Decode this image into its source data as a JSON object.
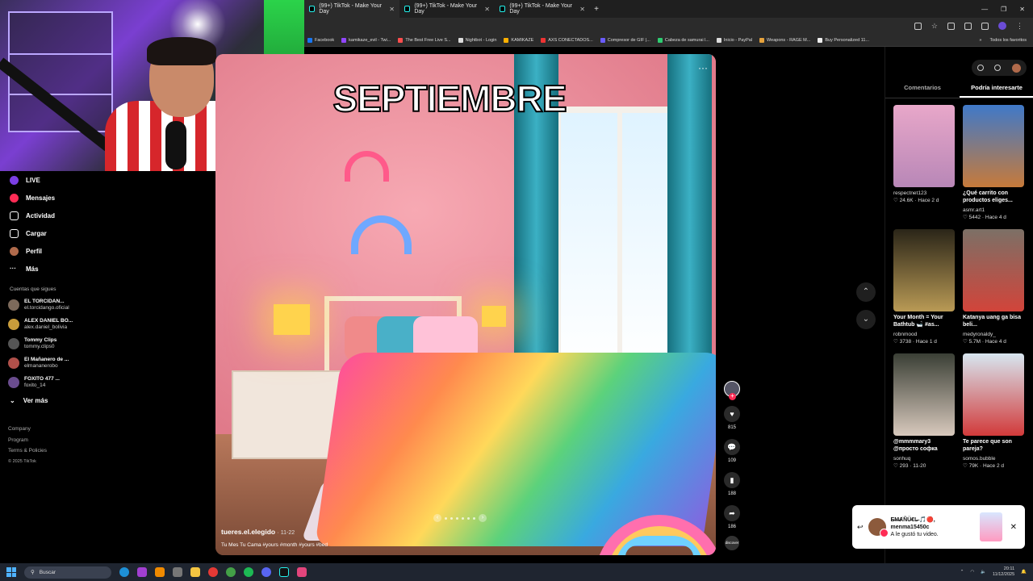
{
  "browser": {
    "tabs": [
      {
        "label": "(99+) TikTok - Make Your Day"
      },
      {
        "label": "(99+) TikTok - Make Your Day"
      },
      {
        "label": "(99+) TikTok - Make Your Day"
      }
    ],
    "bookmarks": [
      {
        "label": "Facebook"
      },
      {
        "label": "kamikaze_evil - Twi..."
      },
      {
        "label": "The Best Free Live S..."
      },
      {
        "label": "Nightbot - Login"
      },
      {
        "label": "KAMIKAZE"
      },
      {
        "label": "AXS CONECTADOS..."
      },
      {
        "label": "Compresor de GIF |..."
      },
      {
        "label": "Cabeza de samurai l..."
      },
      {
        "label": "Inicio - PayPal"
      },
      {
        "label": "Weapons - RAGE M..."
      },
      {
        "label": "Buy Personalized 11..."
      }
    ],
    "bookmarks_more": "»",
    "all_favorites": "Todos los favoritos"
  },
  "sidebar": {
    "nav": [
      {
        "label": "LIVE",
        "icon": "live-icon"
      },
      {
        "label": "Mensajes",
        "icon": "messages-icon"
      },
      {
        "label": "Actividad",
        "icon": "activity-icon"
      },
      {
        "label": "Cargar",
        "icon": "upload-icon"
      },
      {
        "label": "Perfil",
        "icon": "profile-icon"
      },
      {
        "label": "Más",
        "icon": "more-icon"
      }
    ],
    "following_title": "Cuentas que sigues",
    "following": [
      {
        "name": "EL TORCIDAN...",
        "handle": "el.torcidango.oficial"
      },
      {
        "name": "ALEX DANIEL BO...",
        "handle": "alex.daniel_bolivia"
      },
      {
        "name": "Tommy Clips",
        "handle": "tommy.clips0"
      },
      {
        "name": "El Mañanero de ...",
        "handle": "elmananerobo"
      },
      {
        "name": "FOXITO 477 ...",
        "handle": "foxito_14"
      }
    ],
    "see_more": "Ver más",
    "footer": [
      "Company",
      "Program",
      "Terms & Policies"
    ],
    "copyright": "© 2025 TikTok"
  },
  "video": {
    "headline": "SEPTIEMBRE",
    "author": "tueres.el.elegido",
    "date": "· 11-22",
    "caption": "Tu Mes Tu Cama #yours #month #yours #bed",
    "likes": "815",
    "comments": "109",
    "saves": "188",
    "shares": "186",
    "discover": "discover"
  },
  "right_panel": {
    "tabs": [
      "Comentarios",
      "Podría interesarte"
    ],
    "cards": [
      {
        "title": "",
        "user": "respectnet123",
        "meta": "♡ 24.6K · Hace 2 d",
        "colors": [
          "#e8a7c9",
          "#b887b7"
        ]
      },
      {
        "title": "¿Qué carrito con productos eliges...",
        "user": "asmr.art1",
        "meta": "♡ 5442 · Hace 4 d",
        "colors": [
          "#3f79c9",
          "#c77a3a"
        ]
      },
      {
        "title": "Your Month = Your Bathtub 🛁 #as...",
        "user": "robnmood",
        "meta": "♡ 3738 · Hace 1 d",
        "colors": [
          "#2a2518",
          "#b99a55"
        ]
      },
      {
        "title": "Katanya uang ga bisa beli...",
        "user": "medyronaldy_",
        "meta": "♡ 5.7M · Hace 4 d",
        "colors": [
          "#7c7066",
          "#d2443a"
        ]
      },
      {
        "title": "@mmmmary3 @просто софка",
        "user": "sonhuq",
        "meta": "♡ 293 · 11-20",
        "colors": [
          "#3a3f35",
          "#d8c9bd"
        ]
      },
      {
        "title": "Te parece que son pareja?",
        "user": "somos.bubble",
        "meta": "♡ 79K · Hace 2 d",
        "colors": [
          "#d7e6f0",
          "#d23a3a"
        ]
      }
    ]
  },
  "notification": {
    "title": "E̶M̶ȺÑÜ̶€L̶ 🎵🔴,",
    "user": "menma15450c",
    "text": "A le gustó tu video."
  },
  "taskbar": {
    "search_placeholder": "Buscar",
    "time": "20:11",
    "date": "11/12/2025"
  }
}
